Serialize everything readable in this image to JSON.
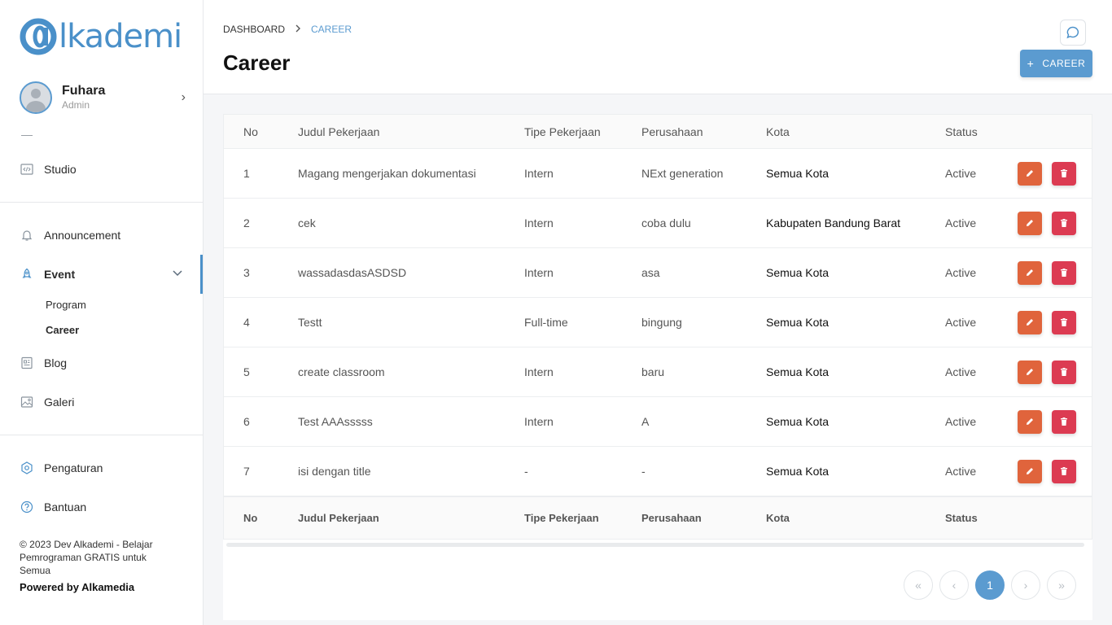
{
  "sidebar": {
    "logo_text": "lkademi",
    "user": {
      "name": "Fuhara",
      "role": "Admin"
    },
    "items_top": [
      {
        "label": "Studio",
        "icon": "code-icon"
      }
    ],
    "items_main": [
      {
        "label": "Announcement",
        "icon": "bell-icon"
      },
      {
        "label": "Event",
        "icon": "rocket-icon",
        "expanded": true,
        "children": [
          {
            "label": "Program"
          },
          {
            "label": "Career",
            "active": true
          }
        ]
      },
      {
        "label": "Blog",
        "icon": "article-icon"
      },
      {
        "label": "Galeri",
        "icon": "image-icon"
      }
    ],
    "items_bottom": [
      {
        "label": "Pengaturan",
        "icon": "settings-icon"
      },
      {
        "label": "Bantuan",
        "icon": "help-icon"
      }
    ],
    "footer": "© 2023 Dev Alkademi - Belajar Pemrograman GRATIS untuk Semua",
    "powered": "Powered by Alkamedia"
  },
  "header": {
    "breadcrumb": [
      "DASHBOARD",
      "CAREER"
    ],
    "title": "Career",
    "add_button": "CAREER"
  },
  "table": {
    "columns": [
      "No",
      "Judul Pekerjaan",
      "Tipe Pekerjaan",
      "Perusahaan",
      "Kota",
      "Status"
    ],
    "rows": [
      [
        "1",
        "Magang mengerjakan dokumentasi",
        "Intern",
        "NExt generation",
        "Semua Kota",
        "Active"
      ],
      [
        "2",
        "cek",
        "Intern",
        "coba dulu",
        "Kabupaten Bandung Barat",
        "Active"
      ],
      [
        "3",
        "wassadasdasASDSD",
        "Intern",
        "asa",
        "Semua Kota",
        "Active"
      ],
      [
        "4",
        "Testt",
        "Full-time",
        "bingung",
        "Semua Kota",
        "Active"
      ],
      [
        "5",
        "create classroom",
        "Intern",
        "baru",
        "Semua Kota",
        "Active"
      ],
      [
        "6",
        "Test AAAsssss",
        "Intern",
        "A",
        "Semua Kota",
        "Active"
      ],
      [
        "7",
        "isi dengan title",
        "-",
        "-",
        "Semua Kota",
        "Active"
      ]
    ]
  },
  "pagination": {
    "first": "«",
    "prev": "‹",
    "current": "1",
    "next": "›",
    "last": "»"
  },
  "colors": {
    "accent": "#5b9bd0",
    "edit": "#e0643c",
    "delete": "#dc3b52"
  }
}
